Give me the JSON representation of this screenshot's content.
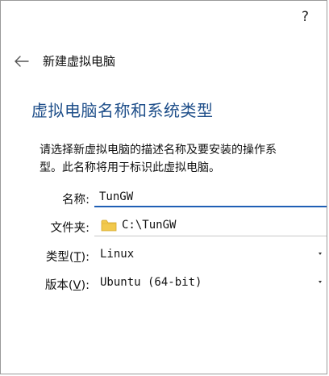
{
  "help": {
    "label": "?"
  },
  "header": {
    "title": "新建虚拟电脑",
    "back_icon": "arrow-left-icon"
  },
  "section": {
    "title": "虚拟电脑名称和系统类型"
  },
  "description": {
    "line1": "请选择新虚拟电脑的描述名称及要安装的操作系",
    "line2": "型。此名称将用于标识此虚拟电脑。"
  },
  "form": {
    "name": {
      "label": "名称:",
      "value": "TunGW"
    },
    "folder": {
      "label": "文件夹:",
      "value": "C:\\TunGW",
      "icon": "folder-icon",
      "icon_color": "#f2c94c"
    },
    "type": {
      "label_prefix": "类型(",
      "label_key": "T",
      "label_suffix": "):",
      "value": "Linux"
    },
    "version": {
      "label_prefix": "版本(",
      "label_key": "V",
      "label_suffix": "):",
      "value": "Ubuntu (64-bit)"
    }
  },
  "colors": {
    "accent": "#1f5fb5",
    "section_title": "#1f4f8a"
  }
}
